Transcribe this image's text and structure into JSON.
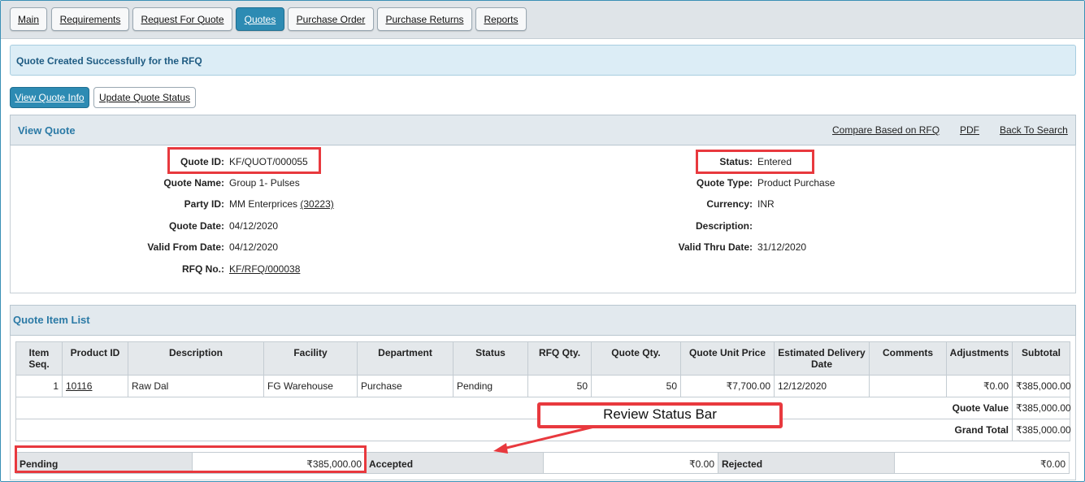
{
  "tabs": [
    {
      "label": "Main"
    },
    {
      "label": "Requirements"
    },
    {
      "label": "Request For Quote"
    },
    {
      "label": "Quotes"
    },
    {
      "label": "Purchase Order"
    },
    {
      "label": "Purchase Returns"
    },
    {
      "label": "Reports"
    }
  ],
  "message": "Quote Created Successfully for the RFQ",
  "subtabs": [
    {
      "label": "View Quote Info"
    },
    {
      "label": "Update Quote Status"
    }
  ],
  "view_quote": {
    "title": "View Quote",
    "links": {
      "compare": "Compare Based on RFQ",
      "pdf": "PDF",
      "back": "Back To Search"
    },
    "fields": {
      "quote_id_label": "Quote ID:",
      "quote_id": "KF/QUOT/000055",
      "quote_name_label": "Quote Name:",
      "quote_name": "Group 1- Pulses",
      "party_id_label": "Party ID:",
      "party_name": "MM Enterprices",
      "party_id": "(30223)",
      "quote_date_label": "Quote Date:",
      "quote_date": "04/12/2020",
      "valid_from_label": "Valid From Date:",
      "valid_from": "04/12/2020",
      "rfq_no_label": "RFQ No.:",
      "rfq_no": "KF/RFQ/000038",
      "status_label": "Status:",
      "status": "Entered",
      "quote_type_label": "Quote Type:",
      "quote_type": "Product Purchase",
      "currency_label": "Currency:",
      "currency": "INR",
      "description_label": "Description:",
      "description": "",
      "valid_thru_label": "Valid Thru Date:",
      "valid_thru": "31/12/2020"
    }
  },
  "item_list": {
    "title": "Quote Item List",
    "headers": [
      "Item Seq.",
      "Product ID",
      "Description",
      "Facility",
      "Department",
      "Status",
      "RFQ Qty.",
      "Quote Qty.",
      "Quote Unit Price",
      "Estimated Delivery Date",
      "Comments",
      "Adjustments",
      "Subtotal"
    ],
    "row": {
      "seq": "1",
      "product_id": "10116",
      "description": "Raw Dal",
      "facility": "FG Warehouse",
      "department": "Purchase",
      "status": "Pending",
      "rfq_qty": "50",
      "quote_qty": "50",
      "unit_price": "₹7,700.00",
      "delivery_date": "12/12/2020",
      "comments": "",
      "adjustments": "₹0.00",
      "subtotal": "₹385,000.00"
    },
    "quote_value_label": "Quote Value",
    "quote_value": "₹385,000.00",
    "grand_total_label": "Grand Total",
    "grand_total": "₹385,000.00"
  },
  "status_bar": {
    "pending_label": "Pending",
    "pending_value": "₹385,000.00",
    "accepted_label": "Accepted",
    "accepted_value": "₹0.00",
    "rejected_label": "Rejected",
    "rejected_value": "₹0.00"
  },
  "callout": "Review Status Bar",
  "colors": {
    "accent": "#2d8bb3",
    "highlight": "#e8393e",
    "header_text": "#2b7aa6"
  }
}
